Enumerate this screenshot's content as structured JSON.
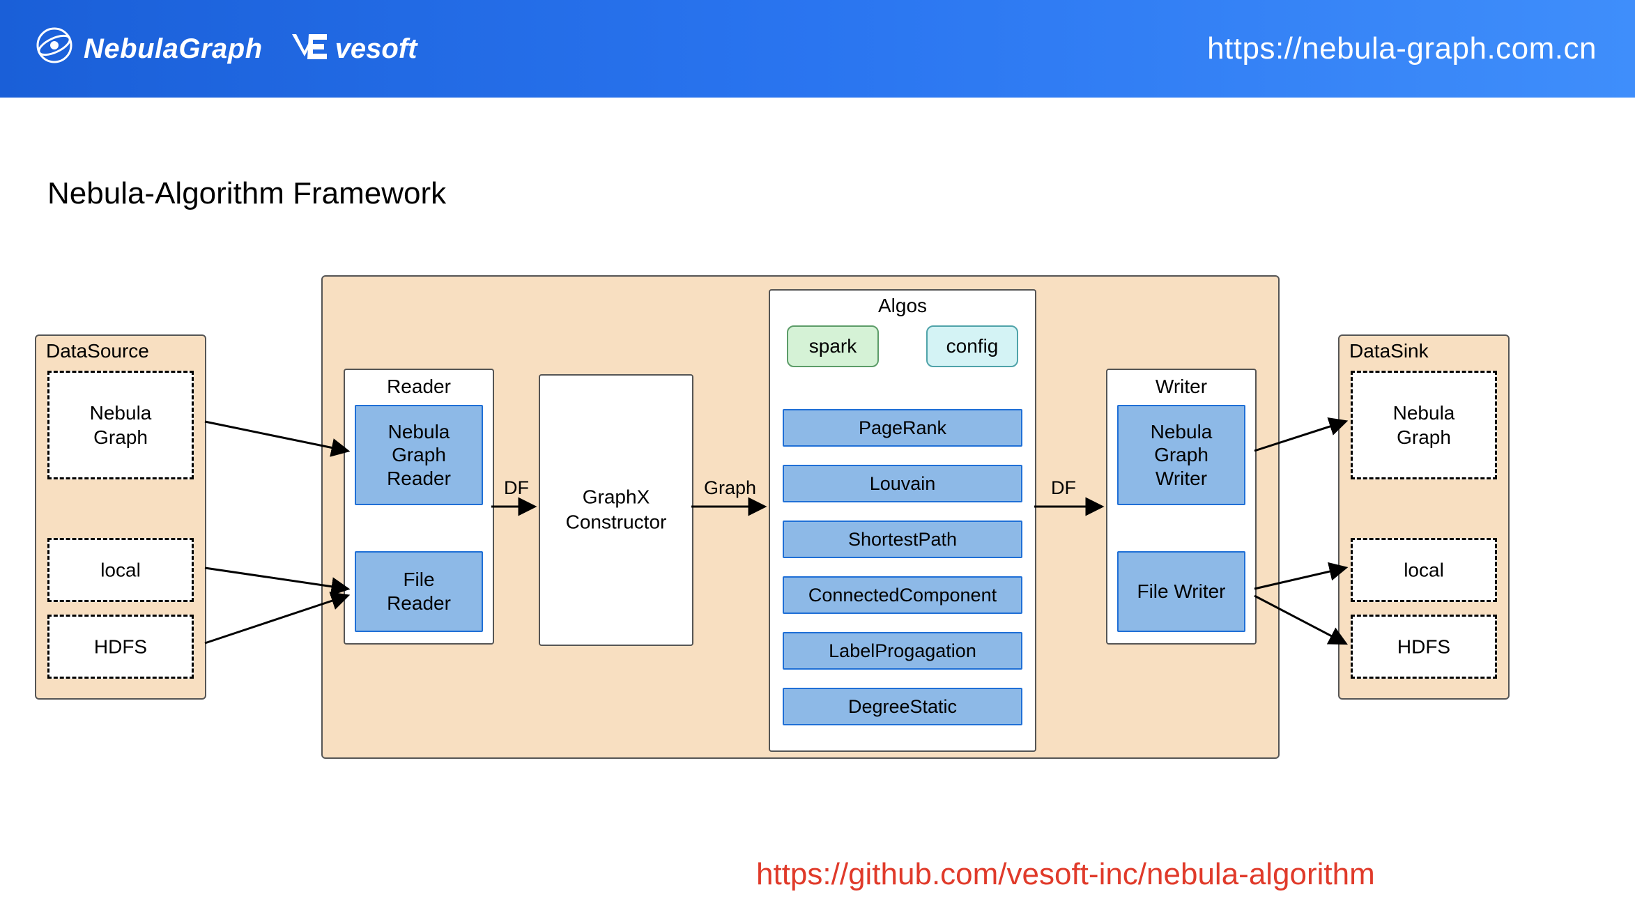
{
  "header": {
    "nebula_name": "NebulaGraph",
    "vesoft_name": "vesoft",
    "url": "https://nebula-graph.com.cn"
  },
  "title": "Nebula-Algorithm  Framework",
  "github_url": "https://github.com/vesoft-inc/nebula-algorithm",
  "datasource": {
    "label": "DataSource",
    "items": [
      "Nebula\nGraph",
      "local",
      "HDFS"
    ]
  },
  "reader": {
    "label": "Reader",
    "items": [
      "Nebula\nGraph\nReader",
      "File\nReader"
    ]
  },
  "graphx": {
    "label": "GraphX\nConstructor"
  },
  "algos": {
    "label": "Algos",
    "params": [
      "spark",
      "config"
    ],
    "items": [
      "PageRank",
      "Louvain",
      "ShortestPath",
      "ConnectedComponent",
      "LabelProgagation",
      "DegreeStatic"
    ]
  },
  "writer": {
    "label": "Writer",
    "items": [
      "Nebula\nGraph\nWriter",
      "File Writer"
    ]
  },
  "datasink": {
    "label": "DataSink",
    "items": [
      "Nebula\nGraph",
      "local",
      "HDFS"
    ]
  },
  "edge_labels": {
    "df1": "DF",
    "graph": "Graph",
    "df2": "DF"
  }
}
